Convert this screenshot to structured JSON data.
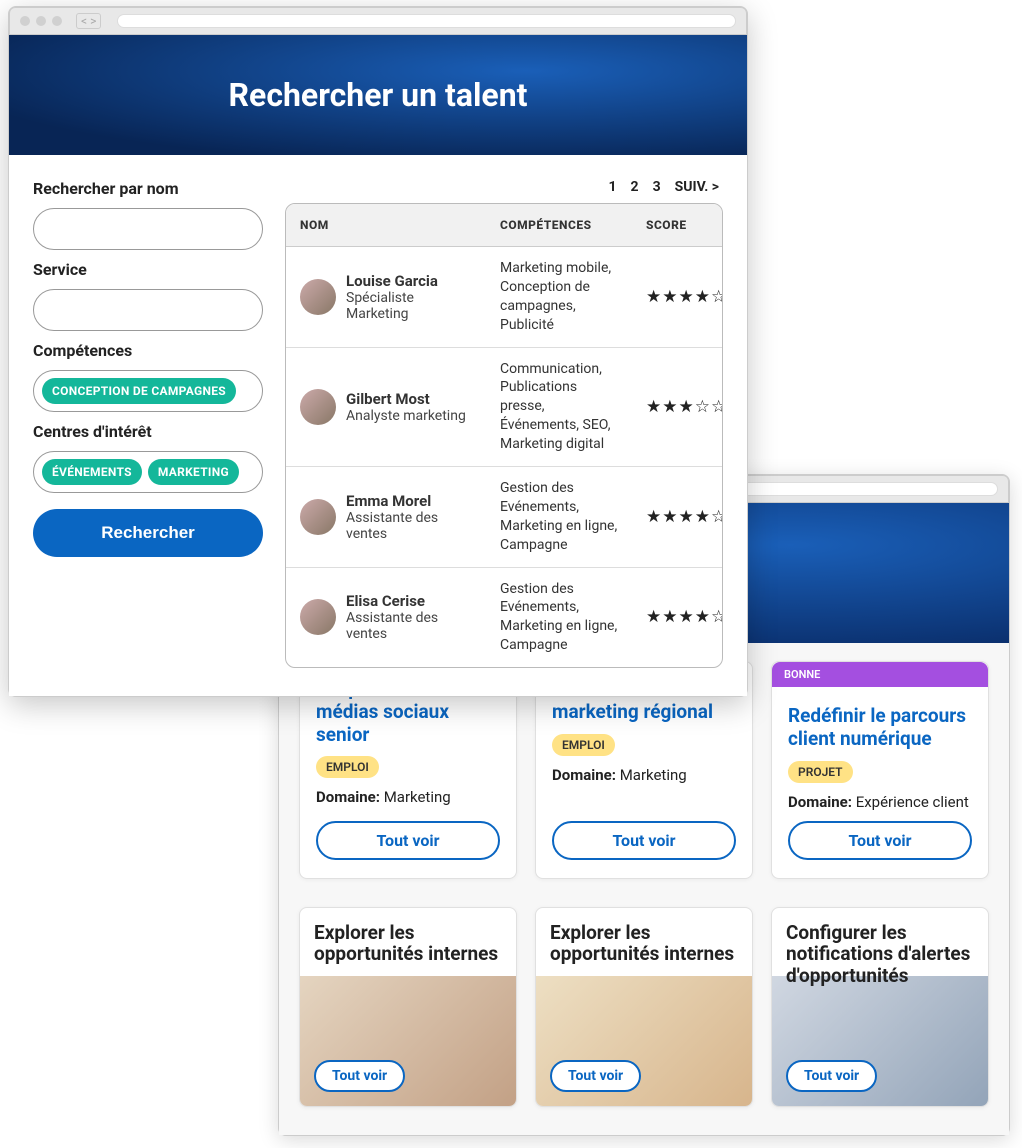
{
  "front": {
    "title": "Rechercher un talent",
    "search": {
      "label_name": "Rechercher par nom",
      "label_service": "Service",
      "label_competences": "Compétences",
      "label_interests": "Centres d'intérêt",
      "chips_competences": [
        "CONCEPTION DE CAMPAGNES"
      ],
      "chips_interests": [
        "ÉVÉNEMENTS",
        "MARKETING"
      ],
      "button": "Rechercher"
    },
    "pager": {
      "pages": [
        "1",
        "2",
        "3"
      ],
      "next": "SUIV. >"
    },
    "table": {
      "headers": {
        "name": "NOM",
        "skills": "COMPÉTENCES",
        "score": "SCORE"
      },
      "rows": [
        {
          "name": "Louise Garcia",
          "role": "Spécialiste Marketing",
          "skills": "Marketing mobile, Conception de campagnes, Publicité",
          "score": 4
        },
        {
          "name": "Gilbert Most",
          "role": "Analyste marketing",
          "skills": "Communication, Publications presse, Événements, SEO, Marketing digital",
          "score": 3
        },
        {
          "name": "Emma Morel",
          "role": "Assistante des ventes",
          "skills": "Gestion des Evénements, Marketing en ligne, Campagne",
          "score": 4
        },
        {
          "name": "Elisa Cerise",
          "role": "Assistante des ventes",
          "skills": "Gestion des Evénements, Marketing en ligne, Campagne",
          "score": 4
        }
      ]
    }
  },
  "back": {
    "badge": "BONNE",
    "cards": [
      {
        "title": "Responsable des médias sociaux senior",
        "tag": "EMPLOI",
        "domain_label": "Domaine:",
        "domain": "Marketing",
        "cta": "Tout voir",
        "badge": ""
      },
      {
        "title": "Coordinateur marketing régional",
        "tag": "EMPLOI",
        "domain_label": "Domaine:",
        "domain": "Marketing",
        "cta": "Tout voir",
        "badge": ""
      },
      {
        "title": "Redéfinir le parcours client numérique",
        "tag": "PROJET",
        "domain_label": "Domaine:",
        "domain": "Expérience client",
        "cta": "Tout voir",
        "badge": "BONNE"
      }
    ],
    "tiles": [
      {
        "title": "Explorer les opportunités internes",
        "cta": "Tout voir"
      },
      {
        "title": "Explorer les opportunités internes",
        "cta": "Tout voir"
      },
      {
        "title": "Configurer les notifications d'alertes d'opportunités",
        "cta": "Tout voir"
      }
    ]
  }
}
